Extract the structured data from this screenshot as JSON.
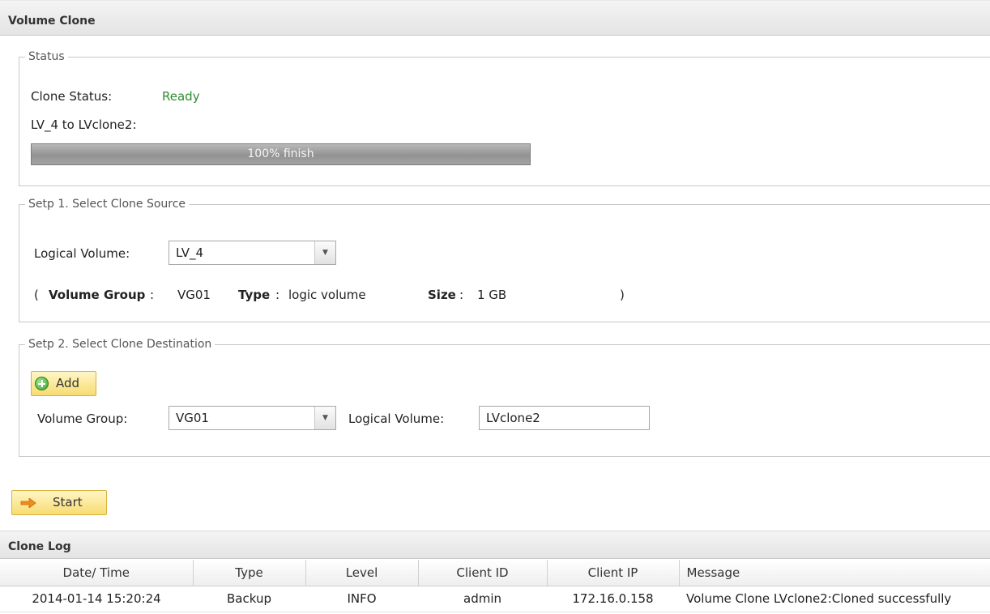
{
  "page_title": "Volume Clone",
  "status": {
    "legend": "Status",
    "clone_status_label": "Clone Status:",
    "clone_status_value": "Ready",
    "clone_status_color": "#2e8b2e",
    "job_label": "LV_4 to LVclone2:",
    "progress_percent": 100,
    "progress_text": "100% finish"
  },
  "step1": {
    "legend": "Setp 1. Select Clone Source",
    "logical_volume_label": "Logical Volume:",
    "logical_volume_value": "LV_4",
    "info_open": "(",
    "volume_group_label": "Volume Group",
    "volume_group_sep": ":",
    "volume_group_value": "VG01",
    "type_label": "Type",
    "type_sep": ":",
    "type_value": "logic volume",
    "size_label": "Size",
    "size_sep": ":",
    "size_value": "1 GB",
    "info_close": ")"
  },
  "step2": {
    "legend": "Setp 2. Select Clone Destination",
    "add_label": "Add",
    "volume_group_label": "Volume Group:",
    "volume_group_value": "VG01",
    "logical_volume_label": "Logical Volume:",
    "logical_volume_value": "LVclone2"
  },
  "start_label": "Start",
  "log": {
    "title": "Clone Log",
    "columns": [
      "Date/ Time",
      "Type",
      "Level",
      "Client ID",
      "Client IP",
      "Message"
    ],
    "rows": [
      [
        "2014-01-14 15:20:24",
        "Backup",
        "INFO",
        "admin",
        "172.16.0.158",
        "Volume Clone LVclone2:Cloned successfully"
      ]
    ]
  },
  "icons": {
    "dropdown": "chevron-down-icon",
    "add": "plus-circle-icon",
    "start": "arrow-right-icon"
  },
  "colors": {
    "button_bg": "#f7dc72",
    "progress_fill": "#a3a3a3"
  }
}
